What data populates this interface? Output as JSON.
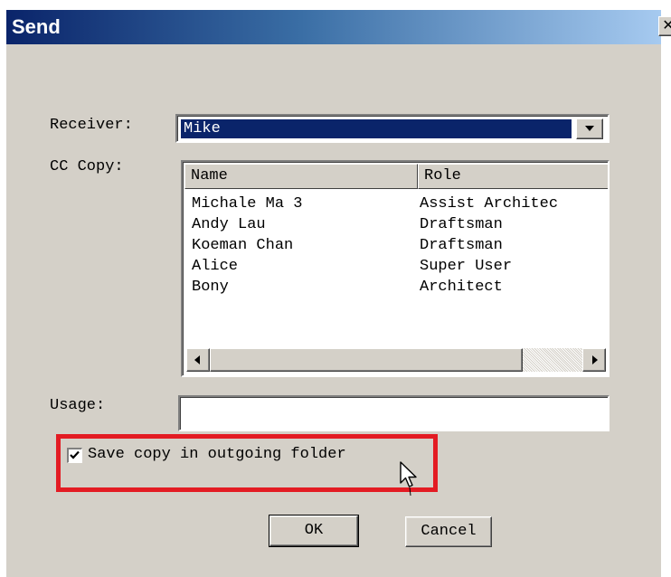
{
  "window": {
    "title": "Send",
    "close_glyph": "✕"
  },
  "receiver": {
    "label": "Receiver:",
    "value": "Mike"
  },
  "cc": {
    "label": "CC Copy:",
    "columns": [
      "Name",
      "Role"
    ],
    "rows": [
      {
        "name": "Michale Ma 3",
        "role": "Assist Architec"
      },
      {
        "name": "Andy Lau",
        "role": "Draftsman"
      },
      {
        "name": "Koeman Chan",
        "role": "Draftsman"
      },
      {
        "name": "Alice",
        "role": "Super User"
      },
      {
        "name": "Bony",
        "role": "Architect"
      }
    ]
  },
  "usage": {
    "label": "Usage:",
    "value": "",
    "placeholder": ""
  },
  "save_copy": {
    "label": "Save copy in outgoing folder",
    "checked": true
  },
  "buttons": {
    "ok": "OK",
    "cancel": "Cancel"
  },
  "colors": {
    "highlight": "#e31b23",
    "title_bar_start": "#0a246a",
    "title_bar_end": "#a6caf0",
    "dialog_bg": "#d4d0c8"
  },
  "icons": {
    "close": "close-icon",
    "dropdown": "chevron-down-icon",
    "scroll_left": "arrow-left-icon",
    "scroll_right": "arrow-right-icon",
    "check": "checkmark-icon",
    "cursor": "mouse-pointer-icon"
  }
}
